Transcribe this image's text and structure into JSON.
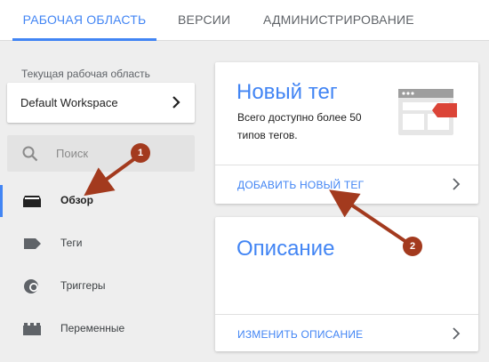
{
  "colors": {
    "accent": "#4285f4",
    "marker": "#a33a1e",
    "icon": "#5f6368"
  },
  "tabs": [
    {
      "label": "РАБОЧАЯ ОБЛАСТЬ",
      "active": true
    },
    {
      "label": "ВЕРСИИ"
    },
    {
      "label": "АДМИНИСТРИРОВАНИЕ"
    }
  ],
  "workspace": {
    "label": "Текущая рабочая область",
    "name": "Default Workspace",
    "icon": "chevron-right-icon"
  },
  "search": {
    "placeholder": "Поиск",
    "icon": "search-icon"
  },
  "nav": [
    {
      "label": "Обзор",
      "icon": "overview-folder-icon",
      "active": true
    },
    {
      "label": "Теги",
      "icon": "tag-icon"
    },
    {
      "label": "Триггеры",
      "icon": "trigger-icon"
    },
    {
      "label": "Переменные",
      "icon": "variable-icon"
    }
  ],
  "new_tag_card": {
    "title": "Новый тег",
    "description": "Всего доступно более 50 типов тегов.",
    "action": "ДОБАВИТЬ НОВЫЙ ТЕГ"
  },
  "description_card": {
    "title": "Описание",
    "action": "ИЗМЕНИТЬ ОПИСАНИЕ"
  },
  "annotations": [
    {
      "number": "1"
    },
    {
      "number": "2"
    }
  ]
}
